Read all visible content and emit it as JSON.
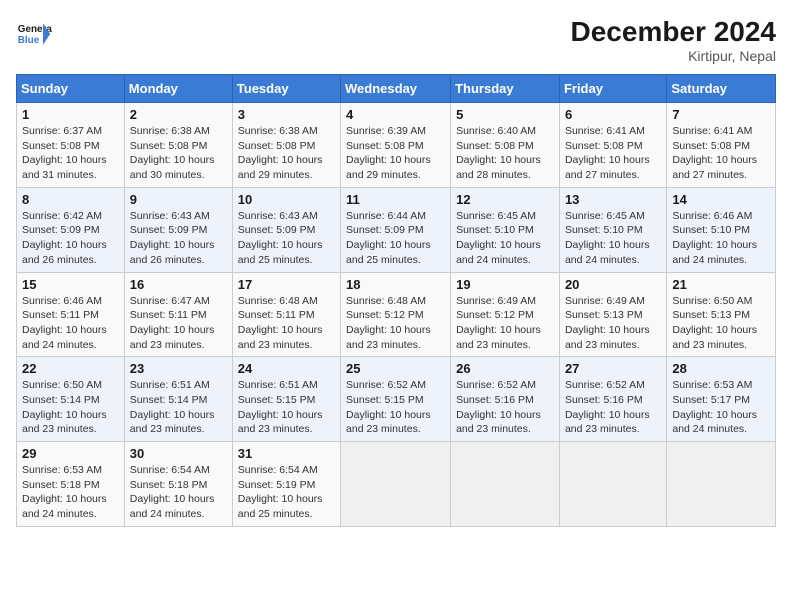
{
  "header": {
    "logo_general": "General",
    "logo_blue": "Blue",
    "month_year": "December 2024",
    "location": "Kirtipur, Nepal"
  },
  "weekdays": [
    "Sunday",
    "Monday",
    "Tuesday",
    "Wednesday",
    "Thursday",
    "Friday",
    "Saturday"
  ],
  "weeks": [
    [
      {
        "day": "1",
        "sunrise": "6:37 AM",
        "sunset": "5:08 PM",
        "daylight": "10 hours and 31 minutes."
      },
      {
        "day": "2",
        "sunrise": "6:38 AM",
        "sunset": "5:08 PM",
        "daylight": "10 hours and 30 minutes."
      },
      {
        "day": "3",
        "sunrise": "6:38 AM",
        "sunset": "5:08 PM",
        "daylight": "10 hours and 29 minutes."
      },
      {
        "day": "4",
        "sunrise": "6:39 AM",
        "sunset": "5:08 PM",
        "daylight": "10 hours and 29 minutes."
      },
      {
        "day": "5",
        "sunrise": "6:40 AM",
        "sunset": "5:08 PM",
        "daylight": "10 hours and 28 minutes."
      },
      {
        "day": "6",
        "sunrise": "6:41 AM",
        "sunset": "5:08 PM",
        "daylight": "10 hours and 27 minutes."
      },
      {
        "day": "7",
        "sunrise": "6:41 AM",
        "sunset": "5:08 PM",
        "daylight": "10 hours and 27 minutes."
      }
    ],
    [
      {
        "day": "8",
        "sunrise": "6:42 AM",
        "sunset": "5:09 PM",
        "daylight": "10 hours and 26 minutes."
      },
      {
        "day": "9",
        "sunrise": "6:43 AM",
        "sunset": "5:09 PM",
        "daylight": "10 hours and 26 minutes."
      },
      {
        "day": "10",
        "sunrise": "6:43 AM",
        "sunset": "5:09 PM",
        "daylight": "10 hours and 25 minutes."
      },
      {
        "day": "11",
        "sunrise": "6:44 AM",
        "sunset": "5:09 PM",
        "daylight": "10 hours and 25 minutes."
      },
      {
        "day": "12",
        "sunrise": "6:45 AM",
        "sunset": "5:10 PM",
        "daylight": "10 hours and 24 minutes."
      },
      {
        "day": "13",
        "sunrise": "6:45 AM",
        "sunset": "5:10 PM",
        "daylight": "10 hours and 24 minutes."
      },
      {
        "day": "14",
        "sunrise": "6:46 AM",
        "sunset": "5:10 PM",
        "daylight": "10 hours and 24 minutes."
      }
    ],
    [
      {
        "day": "15",
        "sunrise": "6:46 AM",
        "sunset": "5:11 PM",
        "daylight": "10 hours and 24 minutes."
      },
      {
        "day": "16",
        "sunrise": "6:47 AM",
        "sunset": "5:11 PM",
        "daylight": "10 hours and 23 minutes."
      },
      {
        "day": "17",
        "sunrise": "6:48 AM",
        "sunset": "5:11 PM",
        "daylight": "10 hours and 23 minutes."
      },
      {
        "day": "18",
        "sunrise": "6:48 AM",
        "sunset": "5:12 PM",
        "daylight": "10 hours and 23 minutes."
      },
      {
        "day": "19",
        "sunrise": "6:49 AM",
        "sunset": "5:12 PM",
        "daylight": "10 hours and 23 minutes."
      },
      {
        "day": "20",
        "sunrise": "6:49 AM",
        "sunset": "5:13 PM",
        "daylight": "10 hours and 23 minutes."
      },
      {
        "day": "21",
        "sunrise": "6:50 AM",
        "sunset": "5:13 PM",
        "daylight": "10 hours and 23 minutes."
      }
    ],
    [
      {
        "day": "22",
        "sunrise": "6:50 AM",
        "sunset": "5:14 PM",
        "daylight": "10 hours and 23 minutes."
      },
      {
        "day": "23",
        "sunrise": "6:51 AM",
        "sunset": "5:14 PM",
        "daylight": "10 hours and 23 minutes."
      },
      {
        "day": "24",
        "sunrise": "6:51 AM",
        "sunset": "5:15 PM",
        "daylight": "10 hours and 23 minutes."
      },
      {
        "day": "25",
        "sunrise": "6:52 AM",
        "sunset": "5:15 PM",
        "daylight": "10 hours and 23 minutes."
      },
      {
        "day": "26",
        "sunrise": "6:52 AM",
        "sunset": "5:16 PM",
        "daylight": "10 hours and 23 minutes."
      },
      {
        "day": "27",
        "sunrise": "6:52 AM",
        "sunset": "5:16 PM",
        "daylight": "10 hours and 23 minutes."
      },
      {
        "day": "28",
        "sunrise": "6:53 AM",
        "sunset": "5:17 PM",
        "daylight": "10 hours and 24 minutes."
      }
    ],
    [
      {
        "day": "29",
        "sunrise": "6:53 AM",
        "sunset": "5:18 PM",
        "daylight": "10 hours and 24 minutes."
      },
      {
        "day": "30",
        "sunrise": "6:54 AM",
        "sunset": "5:18 PM",
        "daylight": "10 hours and 24 minutes."
      },
      {
        "day": "31",
        "sunrise": "6:54 AM",
        "sunset": "5:19 PM",
        "daylight": "10 hours and 25 minutes."
      },
      null,
      null,
      null,
      null
    ]
  ],
  "labels": {
    "sunrise": "Sunrise: ",
    "sunset": "Sunset: ",
    "daylight": "Daylight: "
  }
}
